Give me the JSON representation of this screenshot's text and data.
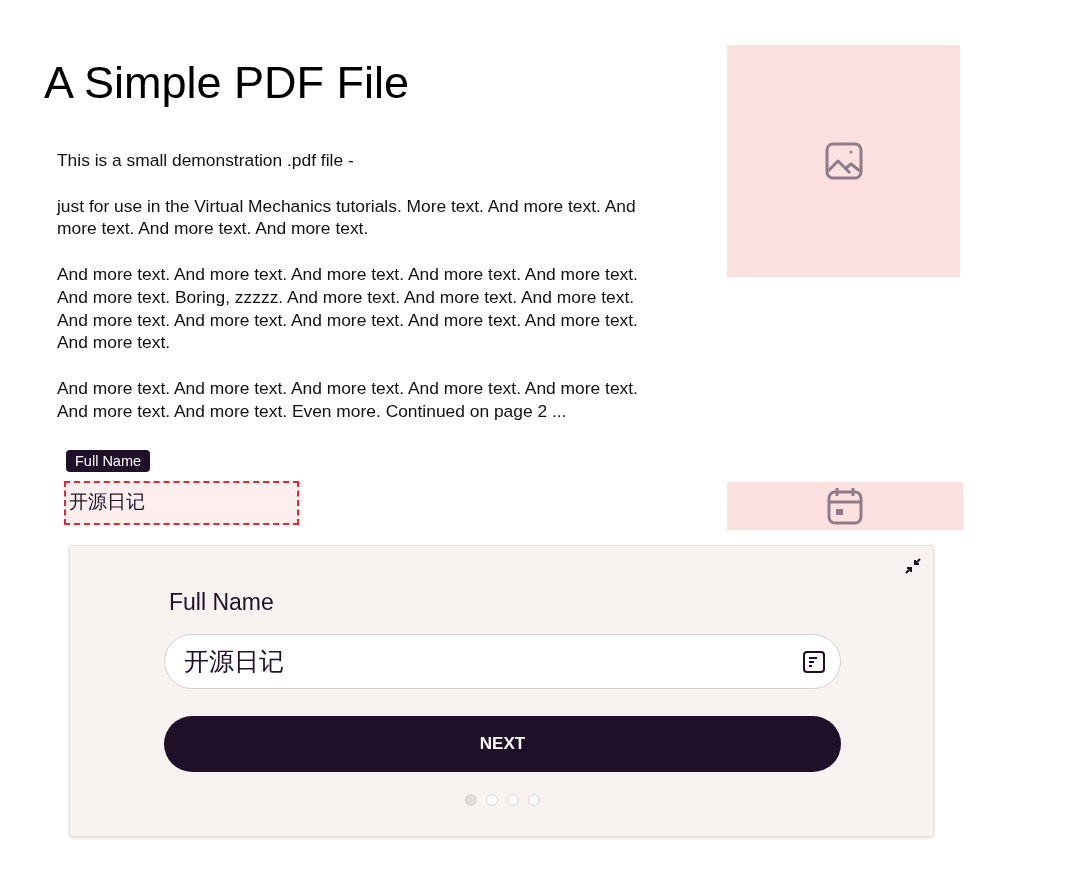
{
  "document": {
    "title": "A Simple PDF File",
    "paragraphs": [
      "This is a small demonstration .pdf file -",
      "just for use in the Virtual Mechanics tutorials. More text. And more text. And more text. And more text. And more text.",
      "And more text. And more text. And more text. And more text. And more text. And more text. Boring, zzzzz. And more text. And more text. And more text. And more text. And more text. And more text. And more text. And more text. And more text.",
      "And more text. And more text. And more text. And more text. And more text. And more text. And more text. Even more. Continued on page 2 ..."
    ]
  },
  "overlay_field": {
    "tag": "Full Name",
    "value": "开源日记"
  },
  "form_card": {
    "label": "Full Name",
    "value": "开源日记",
    "button": "NEXT",
    "pages": [
      {
        "selected": true
      },
      {
        "selected": false
      },
      {
        "selected": false
      },
      {
        "selected": false
      }
    ]
  }
}
